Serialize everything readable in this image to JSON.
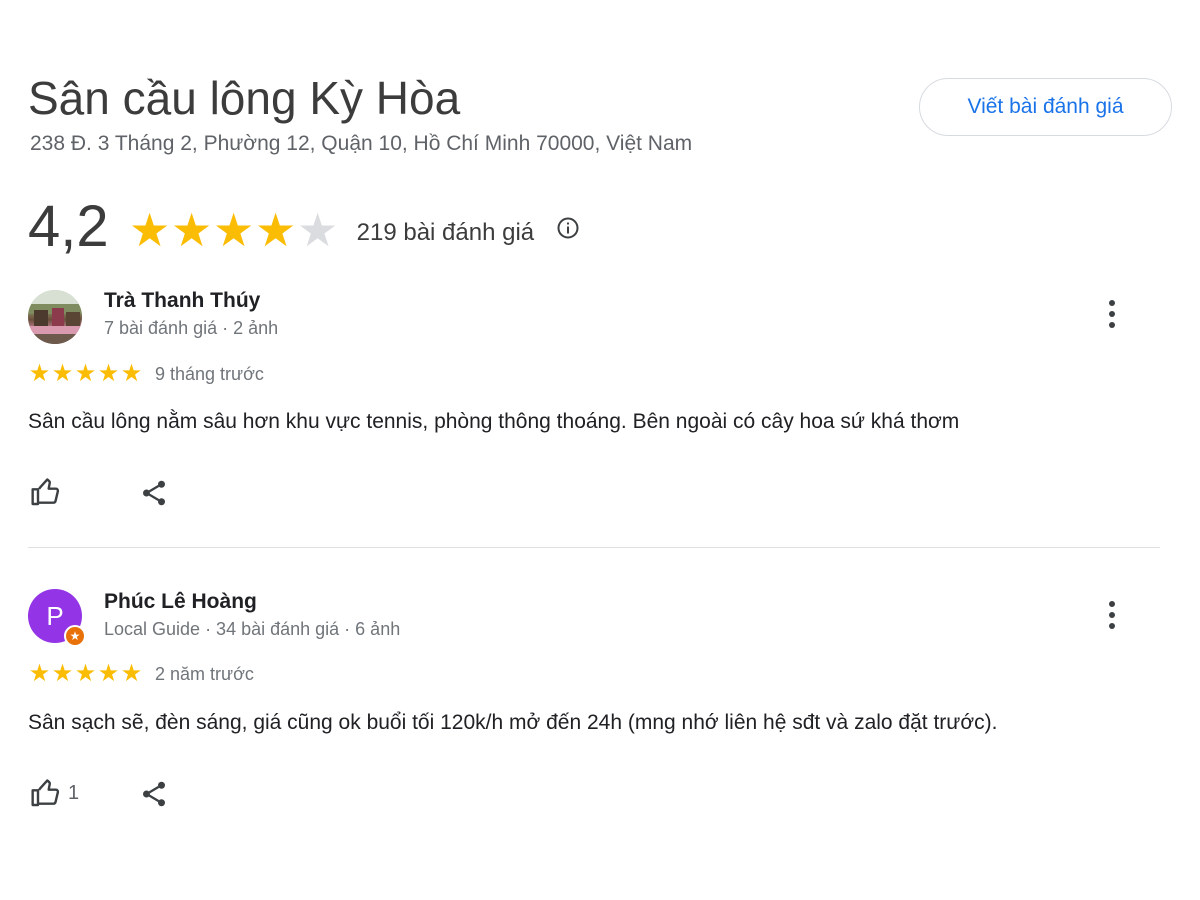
{
  "place": {
    "name": "Sân cầu lông Kỳ Hòa",
    "address": "238 Đ. 3 Tháng 2, Phường 12, Quận 10, Hồ Chí Minh 70000, Việt Nam",
    "write_review_label": "Viết bài đánh giá",
    "rating": "4,2",
    "rating_value": 4.2,
    "stars_max": 5,
    "review_count": "219 bài đánh giá"
  },
  "colors": {
    "star": "#fbbc04",
    "star_off": "#dadce0",
    "accent": "#1a73e8",
    "avatar_purple": "#9334e6",
    "local_guide_badge": "#e8710a"
  },
  "reviews": [
    {
      "author": "Trà Thanh Thúy",
      "meta": "7 bài đánh giá · 2 ảnh",
      "stars": 5,
      "time": "9 tháng trước",
      "text": "Sân cầu lông nằm sâu hơn khu vực tennis, phòng thông thoáng. Bên ngoài có cây hoa sứ khá thơm",
      "likes": "",
      "avatar": "photo"
    },
    {
      "author": "Phúc Lê Hoàng",
      "meta": "Local Guide · 34 bài đánh giá · 6 ảnh",
      "stars": 5,
      "time": "2 năm trước",
      "text": "Sân sạch sẽ, đèn sáng, giá cũng ok buổi tối 120k/h mở đến 24h (mng nhớ liên hệ sđt và zalo đặt trước).",
      "likes": "1",
      "avatar_letter": "P"
    }
  ],
  "icons": {
    "info": "info-icon",
    "more": "more-vert-icon",
    "like": "thumb-up-icon",
    "share": "share-icon",
    "star": "star-icon"
  }
}
